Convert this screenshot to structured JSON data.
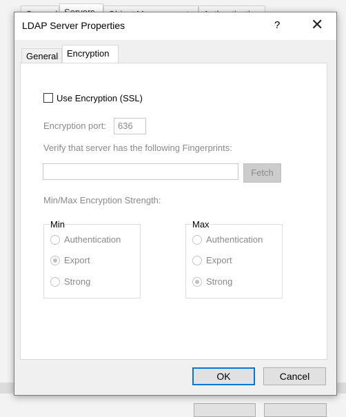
{
  "background": {
    "tabs": [
      "General",
      "Servers",
      "Object Management",
      "Authentication"
    ]
  },
  "dialog": {
    "title": "LDAP Server Properties",
    "help_label": "?",
    "close_label": "✕",
    "tabs": [
      {
        "label": "General",
        "selected": false
      },
      {
        "label": "Encryption",
        "selected": true
      }
    ],
    "use_encryption": {
      "label": "Use Encryption (SSL)",
      "checked": false
    },
    "port": {
      "label": "Encryption port:",
      "value": "636"
    },
    "fingerprints": {
      "label": "Verify that server has the following Fingerprints:",
      "value": "",
      "fetch_label": "Fetch"
    },
    "strength_label": "Min/Max Encryption Strength:",
    "min": {
      "legend": "Min",
      "options": [
        "Authentication",
        "Export",
        "Strong"
      ],
      "selected": "Export"
    },
    "max": {
      "legend": "Max",
      "options": [
        "Authentication",
        "Export",
        "Strong"
      ],
      "selected": "Strong"
    },
    "ok_label": "OK",
    "cancel_label": "Cancel"
  },
  "colors": {
    "accent": "#0078d7",
    "disabled_text": "#8a8a8a"
  }
}
